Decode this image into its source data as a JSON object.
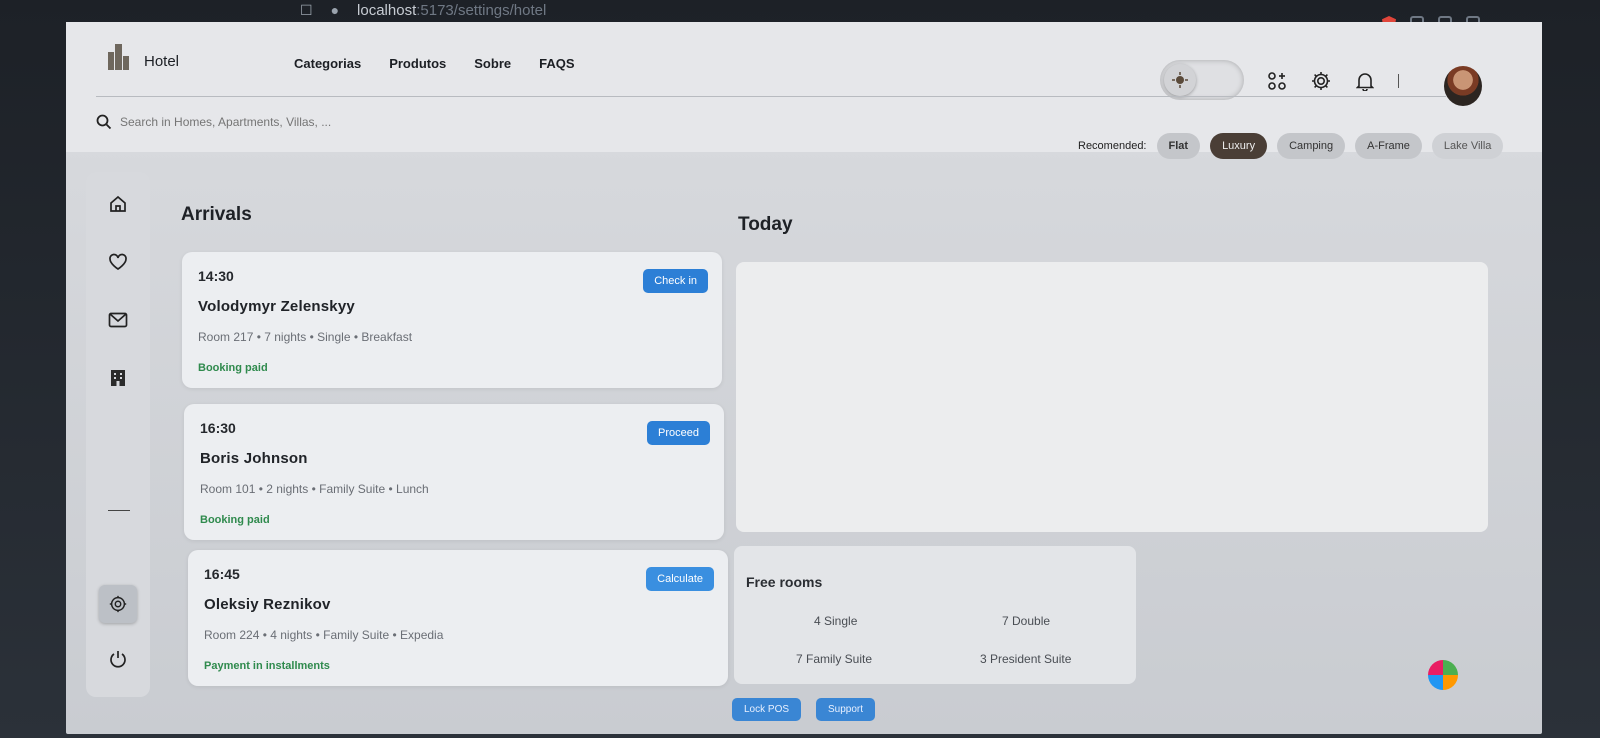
{
  "browser": {
    "url_host": "localhost",
    "url_rest": ":5173/settings/hotel"
  },
  "nav": {
    "brand": "Hotel",
    "menu": [
      "Categorias",
      "Produtos",
      "Sobre",
      "FAQS"
    ]
  },
  "search": {
    "placeholder": "Search in Homes, Apartments, Villas, ..."
  },
  "recommend": {
    "label": "Recomended:",
    "items": [
      "Flat",
      "Luxury",
      "Camping",
      "A-Frame",
      "Lake Villa"
    ],
    "active": "Luxury"
  },
  "arrivals": {
    "title": "Arrivals",
    "cards": [
      {
        "time": "14:30",
        "name": "Volodymyr Zelenskyy",
        "meta": "Room 217 • 7 nights • Single • Breakfast",
        "status": "Booking paid",
        "action": "Check in"
      },
      {
        "time": "16:30",
        "name": "Boris Johnson",
        "meta": "Room 101 • 2 nights • Family Suite • Lunch",
        "status": "Booking paid",
        "action": "Proceed"
      },
      {
        "time": "16:45",
        "name": "Oleksiy Reznikov",
        "meta": "Room 224 • 4 nights • Family Suite • Expedia",
        "status": "Payment in installments",
        "action": "Calculate"
      }
    ]
  },
  "today": {
    "title": "Today"
  },
  "free_rooms": {
    "title": "Free rooms",
    "items": [
      "4 Single",
      "7 Double",
      "7 Family Suite",
      "3 President Suite"
    ]
  },
  "bottom_buttons": [
    "Lock POS",
    "Support"
  ],
  "icons": [
    "home-icon",
    "heart-icon",
    "mail-icon",
    "building-icon",
    "settings-icon",
    "power-icon",
    "search-icon",
    "gear-icon",
    "bell-icon",
    "apps-icon"
  ],
  "colors": {
    "primary": "#2c7fd6",
    "success": "#2f8a4d",
    "active_pill": "#4a3e36"
  }
}
